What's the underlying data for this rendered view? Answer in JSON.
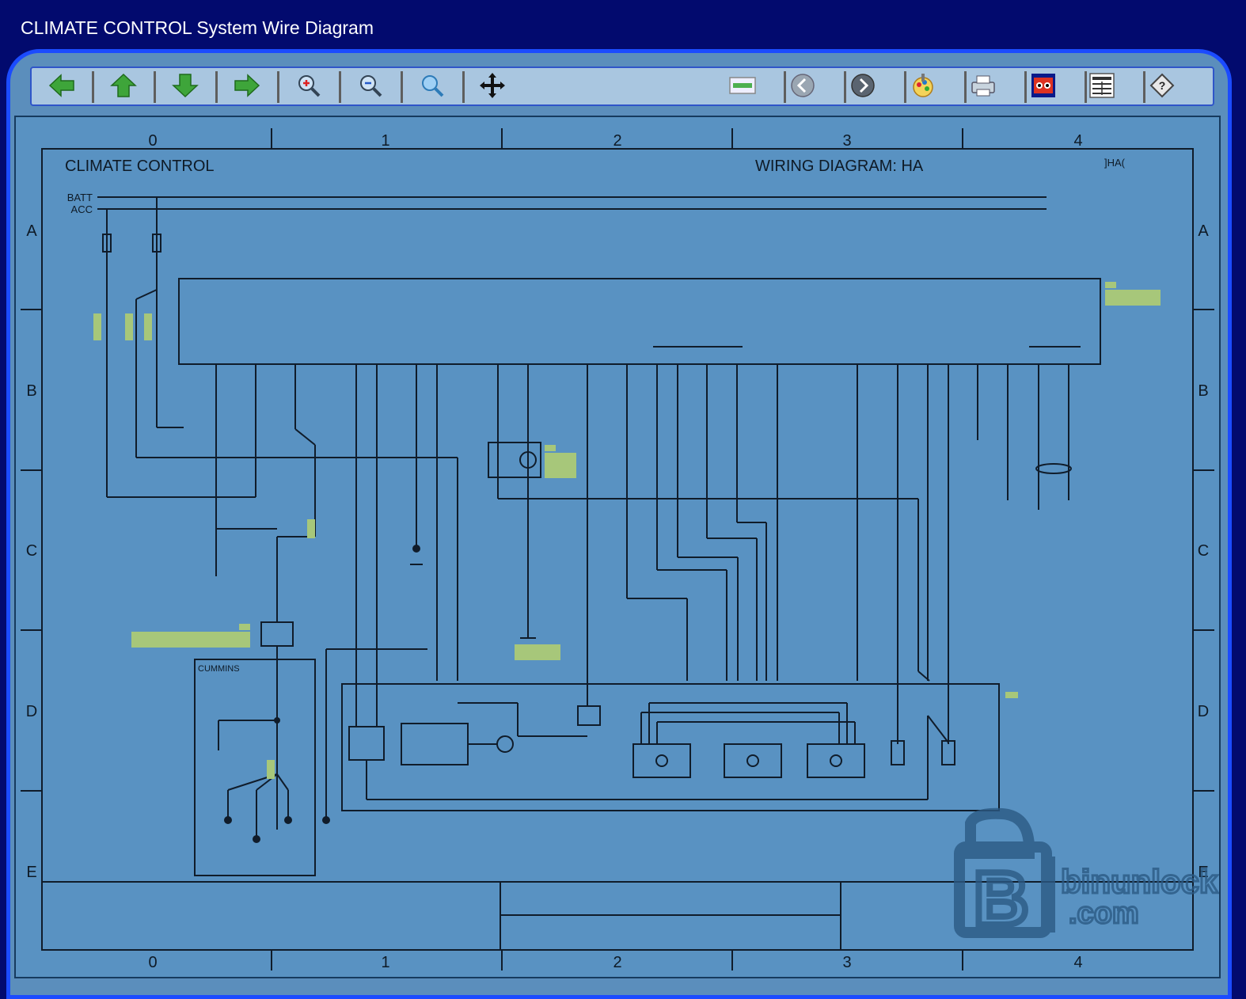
{
  "window": {
    "title": "CLIMATE CONTROL System Wire Diagram"
  },
  "toolbar": {
    "buttons": [
      {
        "icon": "arrow-left-icon"
      },
      {
        "icon": "arrow-up-icon"
      },
      {
        "icon": "arrow-down-icon"
      },
      {
        "icon": "arrow-right-icon"
      },
      {
        "icon": "zoom-in-icon"
      },
      {
        "icon": "zoom-out-icon"
      },
      {
        "icon": "zoom-fit-icon"
      },
      {
        "icon": "pan-icon"
      },
      {
        "icon": "connector-view-icon"
      },
      {
        "icon": "previous-icon"
      },
      {
        "icon": "next-icon"
      },
      {
        "icon": "color-icon"
      },
      {
        "icon": "print-icon"
      },
      {
        "icon": "view-mode-icon"
      },
      {
        "icon": "list-icon"
      },
      {
        "icon": "help-icon"
      }
    ]
  },
  "diagram": {
    "columns": [
      "0",
      "1",
      "2",
      "3",
      "4"
    ],
    "rows": [
      "A",
      "B",
      "C",
      "D",
      "E"
    ],
    "heading_left": "CLIMATE CONTROL",
    "heading_right": "WIRING DIAGRAM: HA",
    "page_code": "]HA(",
    "power_rails": {
      "batt": "BATT",
      "acc": "ACC"
    },
    "sub_box_label": "CUMMINS",
    "colors": {
      "background": "#5992c2",
      "highlight": "#a7c77a",
      "line": "#101c2a"
    }
  },
  "watermark": {
    "line1": "binunlock",
    "line2": ".com"
  }
}
